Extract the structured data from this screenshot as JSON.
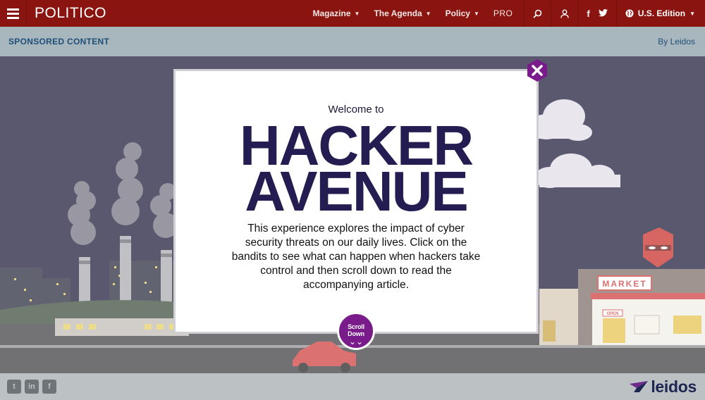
{
  "header": {
    "logo": "POLITICO",
    "nav": [
      {
        "label": "Magazine"
      },
      {
        "label": "The Agenda"
      },
      {
        "label": "Policy"
      }
    ],
    "pro_label": "PRO",
    "edition_label": "U.S. Edition",
    "social_icons": [
      "f",
      "t"
    ]
  },
  "sponsor": {
    "label": "SPONSORED CONTENT",
    "by": "By Leidos"
  },
  "modal": {
    "welcome": "Welcome to",
    "title_line1": "HACKER",
    "title_line2": "AVENUE",
    "description": "This experience explores the impact of cyber security threats on our daily lives. Click on the bandits to see what can happen when hackers take control and then scroll down to read the accompanying article.",
    "scroll_label": "Scroll Down",
    "scroll_arrows": "⌄⌄"
  },
  "scene": {
    "market_sign": "MARKET",
    "open_sign": "OPEN"
  },
  "footer": {
    "share_icons": [
      "t",
      "in",
      "f"
    ],
    "brand": "leidos"
  },
  "colors": {
    "nav_red": "#8a1510",
    "sponsor_grey": "#a8b6be",
    "night_sky": "#1b1838",
    "title_navy": "#231d52",
    "accent_purple": "#7a1b8b"
  }
}
